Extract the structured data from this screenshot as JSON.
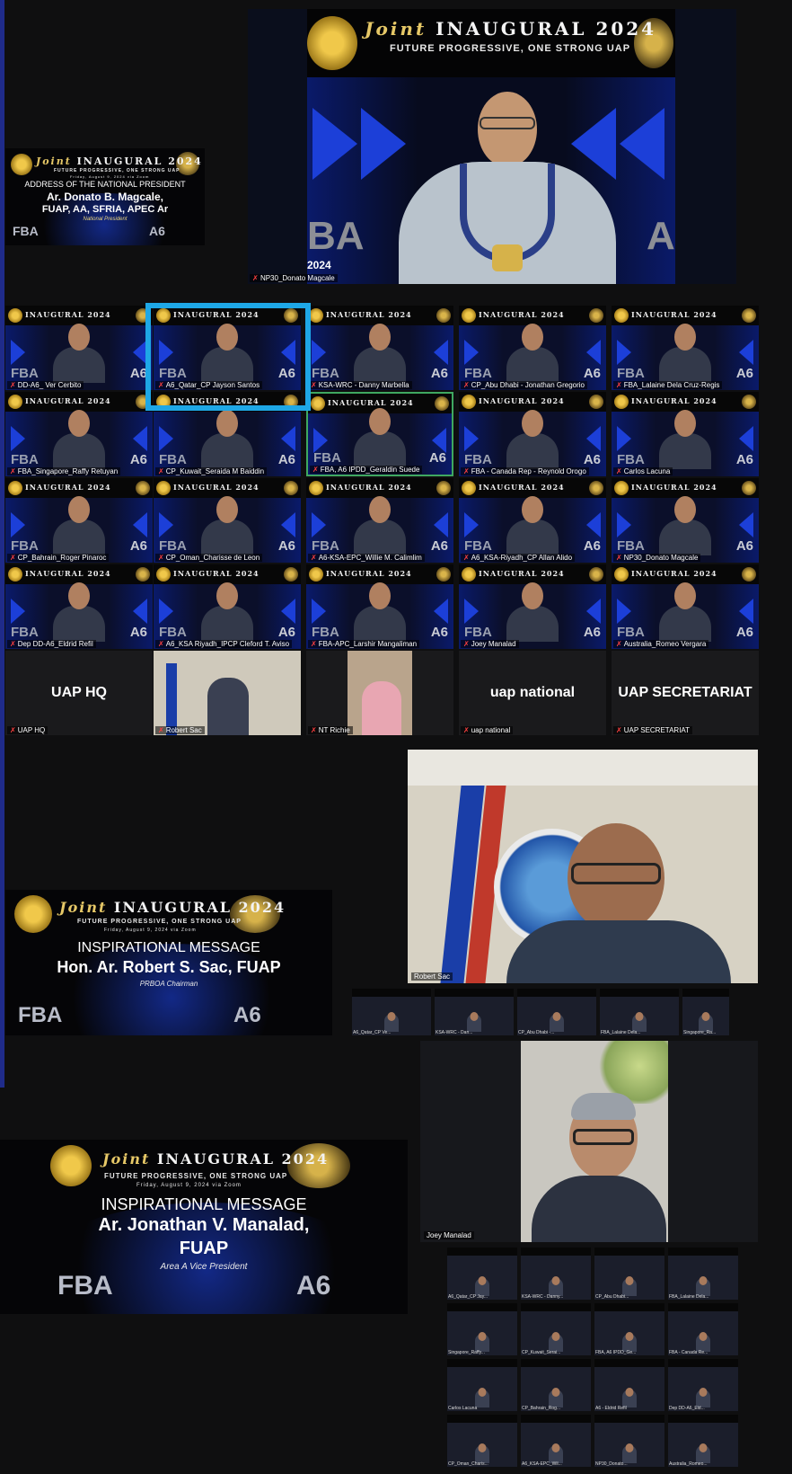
{
  "top_speaker": {
    "banner_title": "INAUGURAL 2024",
    "banner_joint": "Joint",
    "banner_tagline": "FUTURE PROGRESSIVE, ONE STRONG UAP",
    "caption": "NP30_Donato Magcale",
    "left_text": "BA",
    "right_text": "A",
    "year_text": "2024"
  },
  "address_banner": {
    "joint": "Joint",
    "title": "INAUGURAL 2024",
    "tagline": "FUTURE PROGRESSIVE, ONE STRONG UAP",
    "date": "Friday, August 9, 2024 via Zoom",
    "heading": "ADDRESS OF THE NATIONAL PRESIDENT",
    "speaker_line1": "Ar. Donato B. Magcale,",
    "speaker_line2": "FUAP, AA, SFRIA, APEC Ar",
    "role": "National President",
    "fba": "FBA",
    "a6": "A6"
  },
  "gallery": {
    "banner_text": "INAUGURAL 2024",
    "tiles": [
      {
        "name": "DD-A6_ Ver Cerbito"
      },
      {
        "name": "A6_Qatar_CP Jayson Santos"
      },
      {
        "name": "KSA-WRC - Danny Marbella"
      },
      {
        "name": "CP_Abu Dhabi - Jonathan Gregorio"
      },
      {
        "name": "FBA_Lalaine Dela Cruz-Regis"
      },
      {
        "name": "FBA_Singapore_Raffy Retuyan"
      },
      {
        "name": "CP_Kuwait_Seraida M Baiddin"
      },
      {
        "name": "FBA, A6 IPDD_Geraldin Suede"
      },
      {
        "name": "FBA - Canada Rep - Reynold Orogo"
      },
      {
        "name": "Carlos Lacuna"
      },
      {
        "name": "CP_Bahrain_Roger Pinaroc"
      },
      {
        "name": "CP_Oman_Charisse de Leon"
      },
      {
        "name": "A6-KSA-EPC_Willie M. Calimlim"
      },
      {
        "name": "A6_KSA-Riyadh_CP Allan Alido"
      },
      {
        "name": "NP30_Donato Magcale"
      },
      {
        "name": "Dep DD-A6_Eldrid Refil"
      },
      {
        "name": "A6_KSA Riyadh_IPCP Cleford T. Aviso"
      },
      {
        "name": "FBA-APC_Larshir Mangaliman"
      },
      {
        "name": "Joey Manalad"
      },
      {
        "name": "Australia_Romeo Vergara"
      }
    ],
    "fba": "FBA",
    "a6": "A6",
    "row5": [
      {
        "label": "UAP HQ",
        "caption": "UAP HQ"
      },
      {
        "label": "",
        "caption": "Robert Sac"
      },
      {
        "label": "",
        "caption": "NT Richie"
      },
      {
        "label": "uap national",
        "caption": "uap national"
      },
      {
        "label": "UAP SECRETARIAT",
        "caption": "UAP SECRETARIAT"
      }
    ]
  },
  "sac_section": {
    "joint": "Joint",
    "title": "INAUGURAL 2024",
    "tagline": "FUTURE PROGRESSIVE, ONE STRONG UAP",
    "date": "Friday, August 9, 2024 via Zoom",
    "heading": "INSPIRATIONAL MESSAGE",
    "speaker": "Hon. Ar. Robert S. Sac, FUAP",
    "role": "PRBOA Chairman",
    "fba": "FBA",
    "a6": "A6",
    "caption": "Robert Sac",
    "strip": [
      "A6_Qatar_CP Ve...",
      "KSA-WRC - Dan...",
      "CP_Abu Dhabi -...",
      "FBA_Lalaine Dela...",
      "Singapore_Ra..."
    ]
  },
  "manalad_section": {
    "joint": "Joint",
    "title": "INAUGURAL 2024",
    "tagline": "FUTURE PROGRESSIVE, ONE STRONG UAP",
    "date": "Friday, August 9, 2024 via Zoom",
    "heading": "INSPIRATIONAL MESSAGE",
    "speaker_line1": "Ar. Jonathan V. Manalad,",
    "speaker_line2": "FUAP",
    "role": "Area A Vice President",
    "fba": "FBA",
    "a6": "A6",
    "caption": "Joey Manalad",
    "mini": [
      "A6_Qatar_CP Jay...",
      "KSA-WRC - Danny...",
      "CP_Abu Dhabi...",
      "FBA_Lalaine Dela...",
      "Singapore_Raffy...",
      "CP_Kuwait_Serai...",
      "FBA, A6 IPDD_Ge...",
      "FBA - Canada Re...",
      "Carlos Lacuna",
      "CP_Bahrain_Rog...",
      "A6 - Eldrid Refil",
      "Dep DD-A6_Eld...",
      "CP_Oman_Charis...",
      "A6_KSA-EPC_Wil...",
      "NP30_Donato...",
      "Australia_Romeo..."
    ]
  },
  "colors": {
    "highlight": "#1ea7e6",
    "active_border": "#3fa860",
    "page_bg": "#0f0f10",
    "chevron": "#1c3fd8",
    "gold": "#e6c867"
  }
}
